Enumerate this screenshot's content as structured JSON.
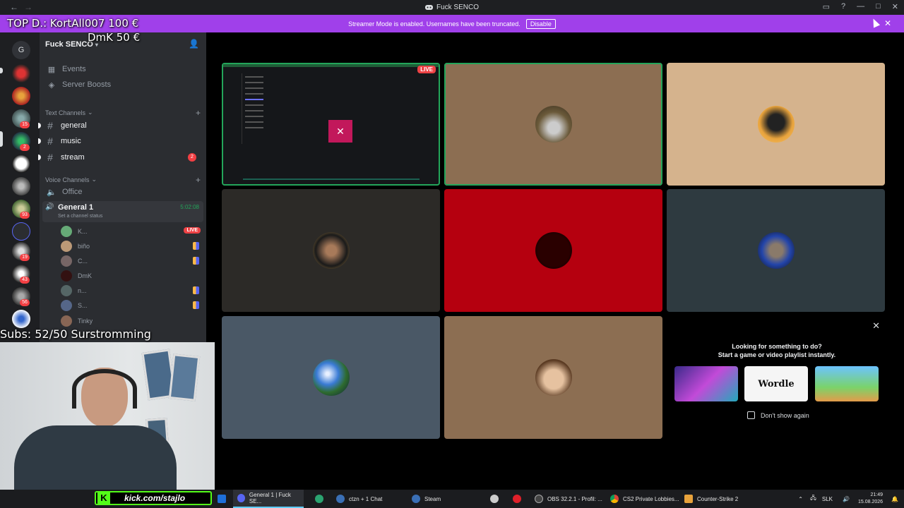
{
  "window": {
    "title": "Fuck SENCO"
  },
  "banner": {
    "text": "Streamer Mode is enabled. Usernames have been truncated.",
    "disable_label": "Disable"
  },
  "overlay": {
    "top_donor": "TOP D.: KortAll007 100 €",
    "donor2": "DmK 50 €",
    "subs": "Subs: 52/50 Surstromming",
    "kick_url": "kick.com/stajlo"
  },
  "rail": {
    "home_letter": "G",
    "badges": [
      "15",
      "2",
      "93",
      "19",
      "43",
      "56"
    ]
  },
  "sidebar": {
    "server_name": "Fuck SENCO",
    "events_label": "Events",
    "boosts_label": "Server Boosts",
    "text_category": "Text Channels",
    "text_channels": [
      {
        "name": "general"
      },
      {
        "name": "music"
      },
      {
        "name": "stream",
        "badge": "2"
      }
    ],
    "voice_category": "Voice Channels",
    "office_label": "Office",
    "active_voice": {
      "name": "General 1",
      "time": "5:02:08",
      "status": "Set a channel status"
    },
    "voice_users": [
      {
        "name": "K...",
        "live": "LIVE"
      },
      {
        "name": "biño"
      },
      {
        "name": "C..."
      },
      {
        "name": "DmK"
      },
      {
        "name": "n..."
      },
      {
        "name": "S..."
      },
      {
        "name": "Tinky"
      }
    ]
  },
  "stage": {
    "live_badge": "LIVE",
    "activity": {
      "line1": "Looking for something to do?",
      "line2": "Start a game or video playlist instantly.",
      "wordle_label": "Wordle",
      "dont_show": "Don't show again"
    }
  },
  "taskbar": {
    "items": [
      {
        "label": "General 1 | Fuck SE..."
      },
      {
        "label": "ctzn + 1 Chat"
      },
      {
        "label": "Steam"
      },
      {
        "label": "OBS 32.2.1 - Profil: ..."
      },
      {
        "label": "CS2 Private Lobbies..."
      },
      {
        "label": "Counter-Strike 2"
      }
    ],
    "lang": "SLK",
    "time": "21:49",
    "date": "15.08.2026"
  },
  "colors": {
    "banner": "#a040ea",
    "speaking_ring": "#23a55a",
    "live_red": "#ed4245",
    "kick_green": "#53fc18"
  },
  "icons": [
    "back-arrow-icon",
    "speaker-icon",
    "hash-icon",
    "calendar-icon",
    "boost-icon",
    "add-user-icon",
    "close-icon",
    "plus-icon",
    "windows-logo-icon"
  ]
}
